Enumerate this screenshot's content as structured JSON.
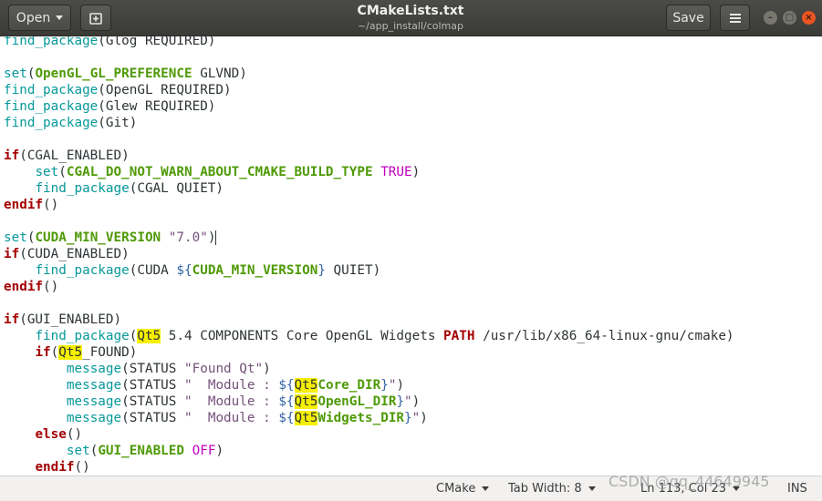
{
  "header": {
    "open_label": "Open",
    "title": "CMakeLists.txt",
    "path": "~/app_install/colmap",
    "save_label": "Save"
  },
  "status": {
    "language": "CMake",
    "tab_width": "Tab Width: 8",
    "position": "Ln 113, Col 23",
    "mode": "INS"
  },
  "watermark": "CSDN @qq_44649945",
  "code_lines": [
    [
      [
        "fn",
        "find_package"
      ],
      [
        "t",
        "(Glog REQUIRED)"
      ]
    ],
    [],
    [
      [
        "fn",
        "set"
      ],
      [
        "t",
        "("
      ],
      [
        "var",
        "OpenGL_GL_PREFERENCE"
      ],
      [
        "t",
        " GLVND)"
      ]
    ],
    [
      [
        "fn",
        "find_package"
      ],
      [
        "t",
        "(OpenGL REQUIRED)"
      ]
    ],
    [
      [
        "fn",
        "find_package"
      ],
      [
        "t",
        "(Glew REQUIRED)"
      ]
    ],
    [
      [
        "fn",
        "find_package"
      ],
      [
        "t",
        "(Git)"
      ]
    ],
    [],
    [
      [
        "kw",
        "if"
      ],
      [
        "t",
        "(CGAL_ENABLED)"
      ]
    ],
    [
      [
        "t",
        "    "
      ],
      [
        "fn",
        "set"
      ],
      [
        "t",
        "("
      ],
      [
        "var",
        "CGAL_DO_NOT_WARN_ABOUT_CMAKE_BUILD_TYPE"
      ],
      [
        "t",
        " "
      ],
      [
        "bool",
        "TRUE"
      ],
      [
        "t",
        ")"
      ]
    ],
    [
      [
        "t",
        "    "
      ],
      [
        "fn",
        "find_package"
      ],
      [
        "t",
        "(CGAL QUIET)"
      ]
    ],
    [
      [
        "kw",
        "endif"
      ],
      [
        "t",
        "()"
      ]
    ],
    [],
    [
      [
        "fn",
        "set"
      ],
      [
        "t",
        "("
      ],
      [
        "var",
        "CUDA_MIN_VERSION"
      ],
      [
        "t",
        " "
      ],
      [
        "strp",
        "\"7.0\""
      ],
      [
        "t",
        ")"
      ],
      [
        "cur",
        ""
      ]
    ],
    [
      [
        "kw",
        "if"
      ],
      [
        "t",
        "(CUDA_ENABLED)"
      ]
    ],
    [
      [
        "t",
        "    "
      ],
      [
        "fn",
        "find_package"
      ],
      [
        "t",
        "(CUDA "
      ],
      [
        "vr2",
        "${"
      ],
      [
        "var",
        "CUDA_MIN_VERSION"
      ],
      [
        "vr2",
        "}"
      ],
      [
        "t",
        " QUIET)"
      ]
    ],
    [
      [
        "kw",
        "endif"
      ],
      [
        "t",
        "()"
      ]
    ],
    [],
    [
      [
        "kw",
        "if"
      ],
      [
        "t",
        "(GUI_ENABLED)"
      ]
    ],
    [
      [
        "t",
        "    "
      ],
      [
        "fn",
        "find_package"
      ],
      [
        "t",
        "("
      ],
      [
        "hl",
        "Qt5"
      ],
      [
        "t",
        " 5.4 COMPONENTS Core OpenGL Widgets "
      ],
      [
        "kw",
        "PATH"
      ],
      [
        "t",
        " /usr/lib/x86_64-linux-gnu/cmake)"
      ]
    ],
    [
      [
        "t",
        "    "
      ],
      [
        "kw",
        "if"
      ],
      [
        "t",
        "("
      ],
      [
        "hl",
        "Qt5"
      ],
      [
        "t",
        "_FOUND)"
      ]
    ],
    [
      [
        "t",
        "        "
      ],
      [
        "fn",
        "message"
      ],
      [
        "t",
        "(STATUS "
      ],
      [
        "strp",
        "\"Found Qt\""
      ],
      [
        "t",
        ")"
      ]
    ],
    [
      [
        "t",
        "        "
      ],
      [
        "fn",
        "message"
      ],
      [
        "t",
        "(STATUS "
      ],
      [
        "strp",
        "\"  Module : "
      ],
      [
        "vr2",
        "${"
      ],
      [
        "hl",
        "Qt5"
      ],
      [
        "var",
        "Core_DIR"
      ],
      [
        "vr2",
        "}"
      ],
      [
        "strp",
        "\""
      ],
      [
        "t",
        ")"
      ]
    ],
    [
      [
        "t",
        "        "
      ],
      [
        "fn",
        "message"
      ],
      [
        "t",
        "(STATUS "
      ],
      [
        "strp",
        "\"  Module : "
      ],
      [
        "vr2",
        "${"
      ],
      [
        "hl",
        "Qt5"
      ],
      [
        "var",
        "OpenGL_DIR"
      ],
      [
        "vr2",
        "}"
      ],
      [
        "strp",
        "\""
      ],
      [
        "t",
        ")"
      ]
    ],
    [
      [
        "t",
        "        "
      ],
      [
        "fn",
        "message"
      ],
      [
        "t",
        "(STATUS "
      ],
      [
        "strp",
        "\"  Module : "
      ],
      [
        "vr2",
        "${"
      ],
      [
        "hl",
        "Qt5"
      ],
      [
        "var",
        "Widgets_DIR"
      ],
      [
        "vr2",
        "}"
      ],
      [
        "strp",
        "\""
      ],
      [
        "t",
        ")"
      ]
    ],
    [
      [
        "t",
        "    "
      ],
      [
        "kw",
        "else"
      ],
      [
        "t",
        "()"
      ]
    ],
    [
      [
        "t",
        "        "
      ],
      [
        "fn",
        "set"
      ],
      [
        "t",
        "("
      ],
      [
        "var",
        "GUI_ENABLED"
      ],
      [
        "t",
        " "
      ],
      [
        "bool",
        "OFF"
      ],
      [
        "t",
        ")"
      ]
    ],
    [
      [
        "t",
        "    "
      ],
      [
        "kw",
        "endif"
      ],
      [
        "t",
        "()"
      ]
    ]
  ]
}
